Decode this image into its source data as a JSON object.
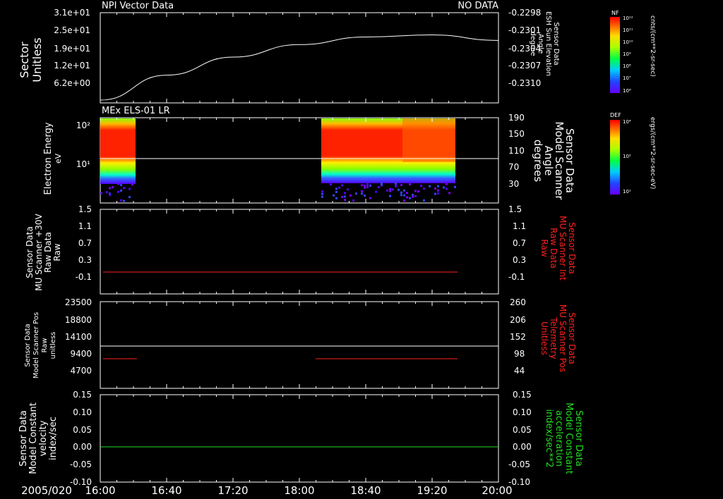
{
  "colors": {
    "background": "#000000",
    "axis": "#ffffff",
    "red": "#ff2020",
    "green": "#22dd22",
    "line": "#ffffff"
  },
  "time_axis": {
    "date": "2005/020",
    "ticks": [
      "16:00",
      "16:40",
      "17:20",
      "18:00",
      "18:40",
      "19:20",
      "20:00"
    ]
  },
  "header": {
    "left": "NPI Vector Data",
    "right": "NO DATA"
  },
  "panel1": {
    "ylabel_left": [
      "Sector",
      "Unitless"
    ],
    "left_ticks": [
      "3.1e+01",
      "2.5e+01",
      "1.9e+01",
      "1.2e+01",
      "6.2e+00"
    ],
    "right_ticks": [
      "-0.2298",
      "-0.2301",
      "-0.2304",
      "-0.2307",
      "-0.2310"
    ],
    "ylabel_right": [
      "Sensor Data",
      "ESH Sun Elevation",
      "Angle",
      "degree"
    ],
    "colorbar": {
      "label": "NF",
      "unit": "cnts/(cm**2-sr-sec)",
      "ticks": [
        "10¹²",
        "10¹¹",
        "10¹⁰",
        "10⁹",
        "10⁸",
        "10⁷",
        "10⁶"
      ]
    }
  },
  "panel2": {
    "title": "MEx ELS-01 LR",
    "ylabel_left": [
      "Electron Energy",
      "eV"
    ],
    "left_ticks": [
      "10²",
      "10¹"
    ],
    "right_ticks": [
      "190",
      "150",
      "110",
      "70",
      "30"
    ],
    "ylabel_right": [
      "Sensor Data",
      "Model Scanner",
      "Angle",
      "degrees"
    ],
    "colorbar": {
      "label": "DEF",
      "unit": "ergs/(cm**2-sr-sec-eV)",
      "ticks": [
        "10⁴",
        "10²",
        "10¹"
      ]
    }
  },
  "panel3": {
    "ylabel_left": [
      "Sensor Data",
      "MU Scanner +30V",
      "Raw Data",
      "Raw"
    ],
    "left_ticks": [
      "1.5",
      "1.1",
      "0.7",
      "0.3",
      "-0.1"
    ],
    "right_ticks": [
      "1.5",
      "1.1",
      "0.7",
      "0.3",
      "-0.1"
    ],
    "ylabel_right": [
      "Sensor Data",
      "MU Scanner Int",
      "Raw Data",
      "Raw"
    ]
  },
  "panel4": {
    "ylabel_left": [
      "Sensor Data",
      "Model Scanner Pos",
      "Raw",
      "unitless"
    ],
    "left_ticks": [
      "23500",
      "18800",
      "14100",
      "9400",
      "4700"
    ],
    "right_ticks": [
      "260",
      "206",
      "152",
      "98",
      "44"
    ],
    "ylabel_right": [
      "Sensor Data",
      "MU Scanner Pos",
      "Telemetry",
      "Unitless"
    ]
  },
  "panel5": {
    "ylabel_left": [
      "Sensor Data",
      "Model Constant",
      "velocity",
      "index/sec"
    ],
    "left_ticks": [
      "0.15",
      "0.10",
      "0.05",
      "0.00",
      "-0.05",
      "-0.10"
    ],
    "right_ticks": [
      "0.15",
      "0.10",
      "0.05",
      "0.00",
      "-0.05",
      "-0.10"
    ],
    "ylabel_right": [
      "Sensor Data",
      "Model Constant",
      "acceleration",
      "index/sec**2"
    ]
  },
  "chart_data": [
    {
      "type": "line",
      "panel": "Sun elevation",
      "x": [
        "16:00",
        "16:40",
        "17:20",
        "18:00",
        "18:40",
        "19:20",
        "20:00"
      ],
      "values": [
        -0.23106,
        -0.2307,
        -0.23044,
        -0.23026,
        -0.23015,
        -0.23012,
        -0.2302
      ],
      "ylim": [
        -0.2311,
        -0.2298
      ]
    },
    {
      "type": "heatmap",
      "panel": "MEx ELS-01 LR",
      "data_intervals": [
        [
          "16:00",
          "16:48"
        ],
        [
          "18:06",
          "19:30"
        ]
      ],
      "ylim_eV": [
        1,
        200
      ]
    },
    {
      "type": "line",
      "panel": "MU Scanner Int",
      "x": [
        "16:00",
        "19:30"
      ],
      "values": [
        -0.05,
        -0.05
      ],
      "ylim": [
        -0.3,
        1.5
      ]
    },
    {
      "type": "line",
      "panel": "MU Scanner Pos",
      "segments": [
        {
          "x": [
            "16:00",
            "16:52"
          ],
          "value": 71
        },
        {
          "x": [
            "18:04",
            "19:30"
          ],
          "value": 71
        }
      ],
      "ylim": [
        0,
        260
      ]
    },
    {
      "type": "line",
      "panel": "Model Scanner Pos",
      "x": [
        "16:00",
        "20:00"
      ],
      "values": [
        11500,
        11500
      ],
      "ylim": [
        0,
        23500
      ]
    },
    {
      "type": "line",
      "panel": "Model Constant",
      "x": [
        "16:00",
        "20:00"
      ],
      "values": [
        0.0,
        0.0
      ],
      "ylim": [
        -0.1,
        0.15
      ]
    }
  ]
}
